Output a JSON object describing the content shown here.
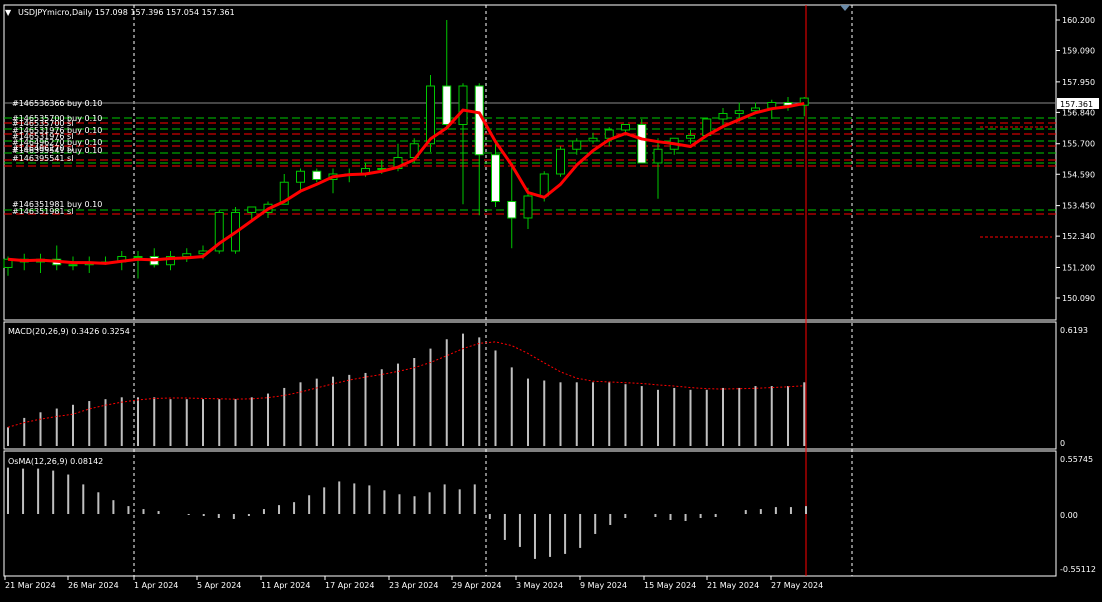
{
  "main": {
    "title": "USDJPYmicro,Daily  157.098 157.396 157.054 157.361",
    "price_labels": [
      "160.200",
      "159.090",
      "157.950",
      "156.840",
      "155.700",
      "154.590",
      "153.450",
      "152.340",
      "151.200",
      "150.090"
    ],
    "current_price": "157.361",
    "order_labels": [
      "#146536366 buy 0.10",
      "#146535700 buy 0.10",
      "#146535700 sl",
      "#146531976 buy 0.10",
      "#146531976 sl",
      "#146496270 buy 0.10",
      "#146496270 sl",
      "#146395541 buy 0.10",
      "#146395541 sl",
      "#146351981 buy 0.10",
      "#146351981 sl"
    ]
  },
  "macd": {
    "title": "MACD(20,26,9) 0.3426 0.3254",
    "labels": [
      "0.6193",
      "0"
    ]
  },
  "osma": {
    "title": "OsMA(12,26,9) 0.08142",
    "labels": [
      "0.55745",
      "0.00",
      "-0.55112"
    ]
  },
  "date_labels": [
    "21 Mar 2024",
    "26 Mar 2024",
    "1 Apr 2024",
    "5 Apr 2024",
    "11 Apr 2024",
    "17 Apr 2024",
    "23 Apr 2024",
    "29 Apr 2024",
    "3 May 2024",
    "9 May 2024",
    "15 May 2024",
    "21 May 2024",
    "27 May 2024"
  ],
  "colors": {
    "bull": "#00c800",
    "bear_fill": "#ffffff",
    "ma": "#ff0000",
    "grid": "#ffffff",
    "order_line": "#00c800",
    "sl_line": "#ff0000",
    "histogram": "#c0c0c0"
  },
  "chart_data": [
    {
      "type": "candlestick",
      "title": "USDJPYmicro,Daily",
      "ylim": [
        150.09,
        160.2
      ],
      "x": [
        "2024-03-21",
        "2024-03-22",
        "2024-03-25",
        "2024-03-26",
        "2024-03-27",
        "2024-03-28",
        "2024-03-29",
        "2024-04-01",
        "2024-04-02",
        "2024-04-03",
        "2024-04-04",
        "2024-04-05",
        "2024-04-08",
        "2024-04-09",
        "2024-04-10",
        "2024-04-11",
        "2024-04-12",
        "2024-04-15",
        "2024-04-16",
        "2024-04-17",
        "2024-04-18",
        "2024-04-19",
        "2024-04-22",
        "2024-04-23",
        "2024-04-24",
        "2024-04-25",
        "2024-04-26",
        "2024-04-29",
        "2024-04-30",
        "2024-05-01",
        "2024-05-02",
        "2024-05-03",
        "2024-05-06",
        "2024-05-07",
        "2024-05-08",
        "2024-05-09",
        "2024-05-10",
        "2024-05-13",
        "2024-05-14",
        "2024-05-15",
        "2024-05-16",
        "2024-05-17",
        "2024-05-20",
        "2024-05-21",
        "2024-05-22",
        "2024-05-23",
        "2024-05-24",
        "2024-05-27",
        "2024-05-28",
        "2024-05-29"
      ],
      "open": [
        151.2,
        151.5,
        151.4,
        151.5,
        151.3,
        151.3,
        151.4,
        151.4,
        151.6,
        151.6,
        151.3,
        151.6,
        151.7,
        151.8,
        151.8,
        153.2,
        153.2,
        153.5,
        154.3,
        154.7,
        154.4,
        154.6,
        154.6,
        154.8,
        154.8,
        155.2,
        155.7,
        157.8,
        156.4,
        157.8,
        155.3,
        153.6,
        153.0,
        153.8,
        154.6,
        155.5,
        155.8,
        155.9,
        156.2,
        156.4,
        155.0,
        155.5,
        155.9,
        156.0,
        156.6,
        156.8,
        156.9,
        157.0,
        157.2,
        157.1
      ],
      "high": [
        151.6,
        151.7,
        151.7,
        152.0,
        151.6,
        151.6,
        151.6,
        151.8,
        151.8,
        151.9,
        151.8,
        151.9,
        152.0,
        153.3,
        153.4,
        153.4,
        153.6,
        154.6,
        154.8,
        154.8,
        154.8,
        154.8,
        155.0,
        155.1,
        155.7,
        155.9,
        158.2,
        160.2,
        157.9,
        157.9,
        155.7,
        155.0,
        154.1,
        154.7,
        155.6,
        155.9,
        156.1,
        156.3,
        156.4,
        156.6,
        155.9,
        155.8,
        156.2,
        156.6,
        157.0,
        157.2,
        157.2,
        157.3,
        157.4,
        157.4
      ],
      "low": [
        150.9,
        151.1,
        151.0,
        151.1,
        151.1,
        151.0,
        151.3,
        151.1,
        150.8,
        151.2,
        151.1,
        151.4,
        151.5,
        151.7,
        151.7,
        152.9,
        153.0,
        153.5,
        154.0,
        154.3,
        153.9,
        154.3,
        154.5,
        154.6,
        154.7,
        155.0,
        155.4,
        156.2,
        153.5,
        153.1,
        153.4,
        151.9,
        152.6,
        153.6,
        154.5,
        155.3,
        155.7,
        155.6,
        156.0,
        156.2,
        153.7,
        155.3,
        155.7,
        156.0,
        156.3,
        156.5,
        156.8,
        156.6,
        156.9,
        156.7
      ],
      "close": [
        151.5,
        151.4,
        151.5,
        151.3,
        151.3,
        151.4,
        151.4,
        151.6,
        151.6,
        151.3,
        151.6,
        151.7,
        151.8,
        153.2,
        153.2,
        153.4,
        153.5,
        154.3,
        154.7,
        154.4,
        154.6,
        154.6,
        154.8,
        154.8,
        155.2,
        155.7,
        157.8,
        156.4,
        157.8,
        155.3,
        153.6,
        153.0,
        153.8,
        154.6,
        155.5,
        155.8,
        155.9,
        156.2,
        156.4,
        155.0,
        155.5,
        155.9,
        156.0,
        156.6,
        156.8,
        156.9,
        157.0,
        157.2,
        157.1,
        157.36
      ]
    },
    {
      "type": "bar",
      "title": "MACD(20,26,9)",
      "ylim": [
        0,
        0.6193
      ],
      "values": [
        0.1,
        0.15,
        0.18,
        0.2,
        0.22,
        0.24,
        0.25,
        0.26,
        0.26,
        0.26,
        0.25,
        0.25,
        0.25,
        0.25,
        0.25,
        0.26,
        0.28,
        0.31,
        0.34,
        0.36,
        0.37,
        0.38,
        0.39,
        0.41,
        0.44,
        0.47,
        0.52,
        0.57,
        0.6,
        0.58,
        0.51,
        0.42,
        0.36,
        0.35,
        0.34,
        0.34,
        0.34,
        0.34,
        0.33,
        0.32,
        0.3,
        0.31,
        0.3,
        0.3,
        0.31,
        0.31,
        0.32,
        0.32,
        0.32,
        0.34
      ]
    },
    {
      "type": "bar",
      "title": "OsMA(12,26,9)",
      "ylim": [
        -0.55112,
        0.55745
      ],
      "values": [
        0.47,
        0.46,
        0.46,
        0.44,
        0.4,
        0.3,
        0.22,
        0.14,
        0.08,
        0.05,
        0.03,
        0.0,
        -0.01,
        -0.02,
        -0.04,
        -0.05,
        -0.02,
        0.05,
        0.09,
        0.12,
        0.19,
        0.27,
        0.33,
        0.31,
        0.29,
        0.24,
        0.2,
        0.18,
        0.22,
        0.3,
        0.25,
        0.3,
        -0.05,
        -0.26,
        -0.33,
        -0.45,
        -0.43,
        -0.4,
        -0.34,
        -0.2,
        -0.11,
        -0.04,
        0.0,
        -0.03,
        -0.06,
        -0.07,
        -0.04,
        -0.03,
        0.0,
        0.04,
        0.05,
        0.07,
        0.07,
        0.08
      ]
    }
  ]
}
